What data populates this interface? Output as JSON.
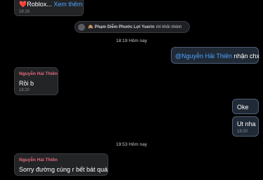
{
  "messages": {
    "top": {
      "heart": "❤️",
      "text": "Roblox...",
      "more": "Xem thêm",
      "time": "18:16"
    },
    "system": {
      "emoji": "🙈",
      "name": "Phạm Diễm Phước Lợi Yuerin",
      "action": "rời khỏi nhóm"
    },
    "sep1": "18:19 Hôm nay",
    "out1": {
      "mention": "@Nguyễn Hải Thiên",
      "text": " nhận chx"
    },
    "in1": {
      "sender": "Nguyễn Hải Thiên",
      "text": "Rồi b",
      "time": "18:20"
    },
    "out2": {
      "text": "Oke"
    },
    "out3": {
      "text": "Ut nha",
      "time": "18:20"
    },
    "sep2": "19:53 Hôm nay",
    "in2": {
      "sender": "Nguyễn Hải Thiên",
      "text": "Sorry đường cùng r bết bát quá"
    }
  },
  "colors": {
    "background": "#000000",
    "sender": "#e36a7e",
    "mention": "#4da3ff",
    "bubble_in": "#222426",
    "bubble_out": "#202a36"
  }
}
